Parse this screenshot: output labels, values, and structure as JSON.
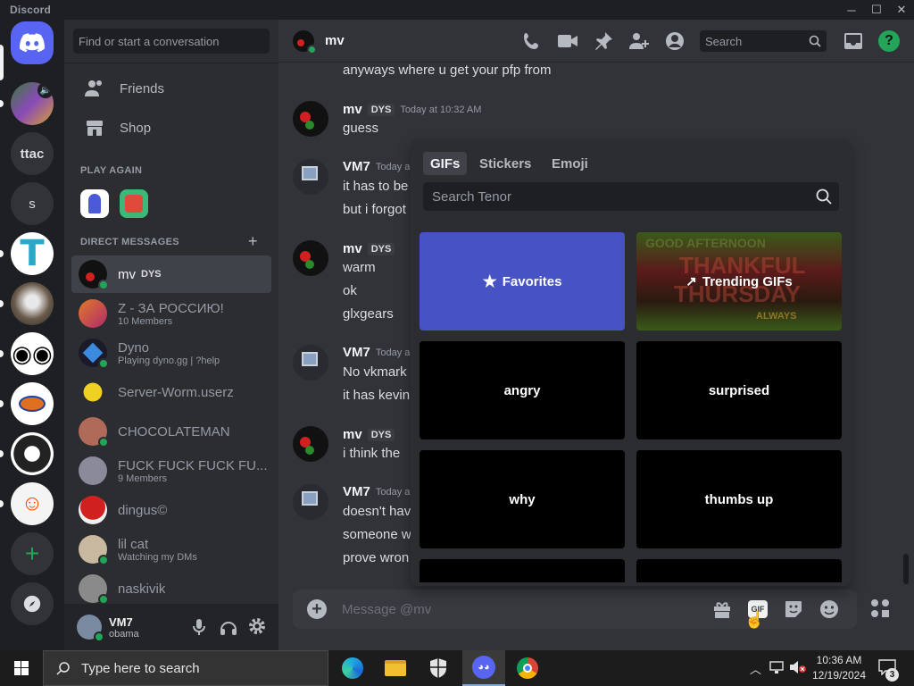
{
  "window": {
    "title": "Discord",
    "minimize": "─",
    "maximize": "☐",
    "close": "✕"
  },
  "guilds": {
    "items": [
      "ttac",
      "s"
    ]
  },
  "sidebar": {
    "search_placeholder": "Find or start a conversation",
    "nav": [
      {
        "label": "Friends",
        "icon": "friends-icon"
      },
      {
        "label": "Shop",
        "icon": "shop-icon"
      }
    ],
    "play_again_title": "PLAY AGAIN",
    "dm_title": "DIRECT MESSAGES",
    "dm_add": "+",
    "dms": [
      {
        "name": "mv",
        "tag": "DYS",
        "sub": "",
        "selected": true
      },
      {
        "name": "Z - ЗА РОССИЮ!",
        "sub": "10 Members"
      },
      {
        "name": "Dyno",
        "sub": "Playing dyno.gg | ?help"
      },
      {
        "name": "Server-Worm.userz",
        "sub": ""
      },
      {
        "name": "CHOCOLATEMAN",
        "sub": ""
      },
      {
        "name": "FUCK FUCK FUCK FU...",
        "sub": "9 Members"
      },
      {
        "name": "dingus©",
        "sub": ""
      },
      {
        "name": "lil cat",
        "sub": "Watching my DMs"
      },
      {
        "name": "naskivik",
        "sub": ""
      }
    ],
    "user": {
      "name": "VM7",
      "status": "obama"
    }
  },
  "header": {
    "channel": "mv",
    "search": "Search"
  },
  "messages": {
    "l0": "anyways where u get your pfp from",
    "g1": {
      "author": "mv",
      "tag": "DYS",
      "time": "Today at 10:32 AM",
      "lines": [
        "guess"
      ]
    },
    "g2": {
      "author": "VM7",
      "time": "Today a",
      "lines": [
        "it has to be",
        "but i forgot"
      ]
    },
    "g3": {
      "author": "mv",
      "tag": "DYS",
      "lines": [
        "warm",
        "ok",
        "glxgears"
      ]
    },
    "g4": {
      "author": "VM7",
      "time": "Today a",
      "lines": [
        "No vkmark",
        "it has kevin"
      ]
    },
    "g5": {
      "author": "mv",
      "tag": "DYS",
      "lines": [
        "i think the"
      ]
    },
    "g6": {
      "author": "VM7",
      "time": "Today a",
      "lines": [
        "doesn't hav",
        "someone w",
        "prove wron"
      ]
    }
  },
  "composer": {
    "placeholder": "Message @mv",
    "gif_label": "GIF"
  },
  "picker": {
    "tabs": [
      "GIFs",
      "Stickers",
      "Emoji"
    ],
    "search_placeholder": "Search Tenor",
    "tiles": [
      {
        "label": "Favorites"
      },
      {
        "label": "Trending GIFs",
        "bg_text": [
          "GOOD AFTERNOON",
          "THANKFUL",
          "THURSDAY",
          "ALWAYS"
        ]
      },
      {
        "label": "angry"
      },
      {
        "label": "surprised"
      },
      {
        "label": "why"
      },
      {
        "label": "thumbs up"
      }
    ]
  },
  "taskbar": {
    "search": "Type here to search",
    "time": "10:36 AM",
    "date": "12/19/2024",
    "notif_count": "3"
  },
  "colors": {
    "blurple": "#5865f2",
    "favorites": "#4752c4",
    "online": "#23a559",
    "bg": "#313338",
    "sidebar": "#2b2d31",
    "rail": "#1e1f22"
  }
}
